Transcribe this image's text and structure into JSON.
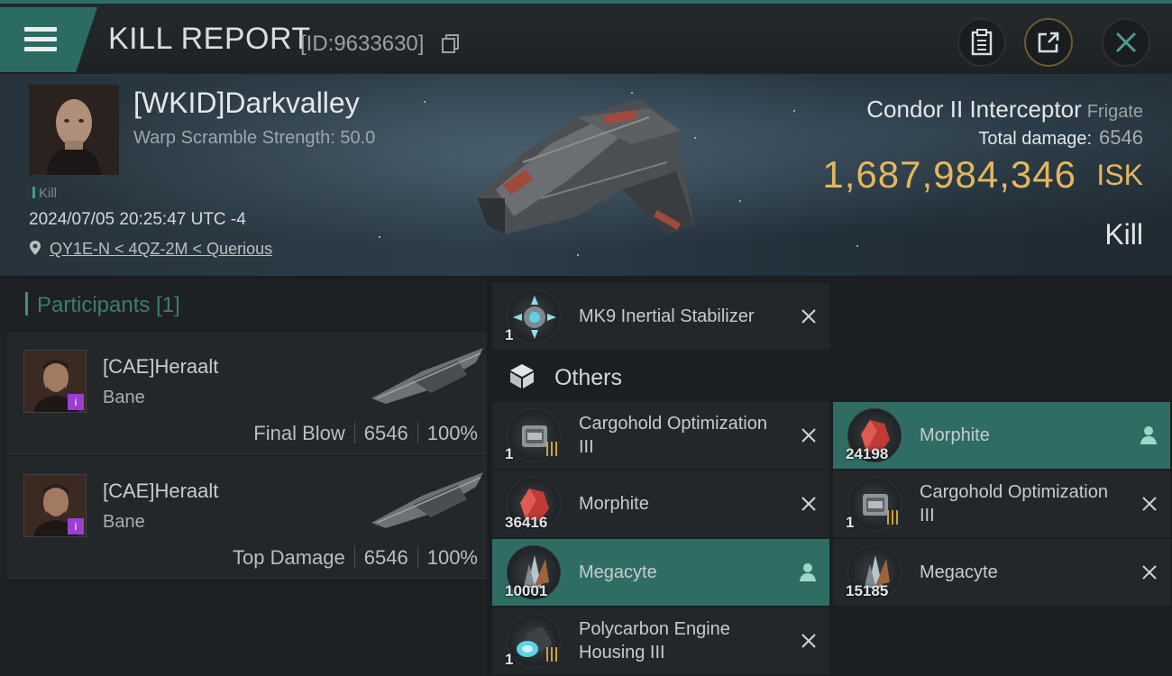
{
  "header": {
    "title": "KILL REPORT",
    "report_id": "[ID:9633630]"
  },
  "victim": {
    "name": "[WKID]Darkvalley",
    "warp_scramble": "Warp Scramble Strength: 50.0",
    "kill_tag": "Kill",
    "timestamp": "2024/07/05 20:25:47 UTC -4",
    "location": "QY1E-N < 4QZ-2M < Querious",
    "ship_name": "Condor II Interceptor",
    "ship_class": "Frigate",
    "total_damage_label": "Total damage:",
    "total_damage": "6546",
    "isk_value": "1,687,984,346",
    "isk_unit": "ISK",
    "result": "Kill"
  },
  "participants": {
    "header": "Participants [1]",
    "rows": [
      {
        "name": "[CAE]Heraalt",
        "ship": "Bane",
        "role": "Final Blow",
        "damage": "6546",
        "percent": "100%"
      },
      {
        "name": "[CAE]Heraalt",
        "ship": "Bane",
        "role": "Top Damage",
        "damage": "6546",
        "percent": "100%"
      }
    ]
  },
  "items": {
    "top": [
      {
        "name": "MK9 Inertial Stabilizer",
        "qty": "1"
      }
    ],
    "others_label": "Others",
    "others": [
      {
        "name": "Cargohold Optimization III",
        "qty": "1",
        "highlight": false
      },
      {
        "name": "Morphite",
        "qty": "24198",
        "highlight": true
      },
      {
        "name": "Morphite",
        "qty": "36416",
        "highlight": false
      },
      {
        "name": "Cargohold Optimization III",
        "qty": "1",
        "highlight": false
      },
      {
        "name": "Megacyte",
        "qty": "10001",
        "highlight": true
      },
      {
        "name": "Megacyte",
        "qty": "15185",
        "highlight": false
      },
      {
        "name": "Polycarbon Engine Housing III",
        "qty": "1",
        "highlight": false
      }
    ]
  },
  "colors": {
    "accent": "#2f6d64",
    "isk": "#e5b75d",
    "badge": "#9a3fd0"
  }
}
